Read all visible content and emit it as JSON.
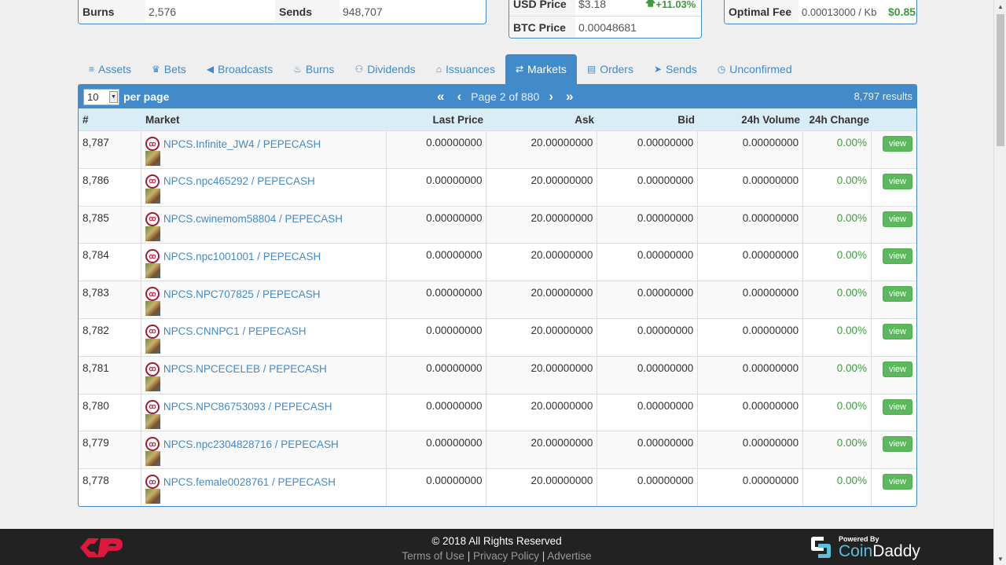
{
  "stats": {
    "burns_label": "Burns",
    "burns_value": "2,576",
    "sends_label": "Sends",
    "sends_value": "948,707",
    "usd_label": "USD Price",
    "usd_value": "$3.18",
    "usd_change": "+11.03%",
    "btc_label": "BTC Price",
    "btc_value": "0.00048681",
    "fee_label": "Optimal Fee",
    "fee_value": "0.00013000 / Kb",
    "fee_usd": "$0.85"
  },
  "tabs": [
    {
      "label": "Assets",
      "icon": "database-icon",
      "glyph": "≡"
    },
    {
      "label": "Bets",
      "icon": "trophy-icon",
      "glyph": "♛"
    },
    {
      "label": "Broadcasts",
      "icon": "bullhorn-icon",
      "glyph": "◀"
    },
    {
      "label": "Burns",
      "icon": "fire-icon",
      "glyph": "♨"
    },
    {
      "label": "Dividends",
      "icon": "sitemap-icon",
      "glyph": "⚇"
    },
    {
      "label": "Issuances",
      "icon": "bank-icon",
      "glyph": "⌂"
    },
    {
      "label": "Markets",
      "icon": "exchange-icon",
      "glyph": "⇄"
    },
    {
      "label": "Orders",
      "icon": "book-icon",
      "glyph": "▤"
    },
    {
      "label": "Sends",
      "icon": "paper-plane-icon",
      "glyph": "➤"
    },
    {
      "label": "Unconfirmed",
      "icon": "clock-icon",
      "glyph": "◷"
    }
  ],
  "active_tab": "Markets",
  "table": {
    "per_page_value": "10",
    "per_page_label": "per page",
    "page_text": "Page 2 of 880",
    "results": "8,797 results",
    "columns": [
      "#",
      "Market",
      "Last Price",
      "Ask",
      "Bid",
      "24h Volume",
      "24h Change"
    ],
    "view_label": "view",
    "rows": [
      {
        "id": "8,787",
        "market": "NPCS.Infinite_JW4 / PEPECASH",
        "last": "0.00000000",
        "ask": "20.00000000",
        "bid": "0.00000000",
        "volume": "0.00000000",
        "change": "0.00%"
      },
      {
        "id": "8,786",
        "market": "NPCS.npc465292 / PEPECASH",
        "last": "0.00000000",
        "ask": "20.00000000",
        "bid": "0.00000000",
        "volume": "0.00000000",
        "change": "0.00%"
      },
      {
        "id": "8,785",
        "market": "NPCS.cwinemom58804 / PEPECASH",
        "last": "0.00000000",
        "ask": "20.00000000",
        "bid": "0.00000000",
        "volume": "0.00000000",
        "change": "0.00%"
      },
      {
        "id": "8,784",
        "market": "NPCS.npc1001001 / PEPECASH",
        "last": "0.00000000",
        "ask": "20.00000000",
        "bid": "0.00000000",
        "volume": "0.00000000",
        "change": "0.00%"
      },
      {
        "id": "8,783",
        "market": "NPCS.NPC707825 / PEPECASH",
        "last": "0.00000000",
        "ask": "20.00000000",
        "bid": "0.00000000",
        "volume": "0.00000000",
        "change": "0.00%"
      },
      {
        "id": "8,782",
        "market": "NPCS.CNNPC1 / PEPECASH",
        "last": "0.00000000",
        "ask": "20.00000000",
        "bid": "0.00000000",
        "volume": "0.00000000",
        "change": "0.00%"
      },
      {
        "id": "8,781",
        "market": "NPCS.NPCECELEB / PEPECASH",
        "last": "0.00000000",
        "ask": "20.00000000",
        "bid": "0.00000000",
        "volume": "0.00000000",
        "change": "0.00%"
      },
      {
        "id": "8,780",
        "market": "NPCS.NPC86753093 / PEPECASH",
        "last": "0.00000000",
        "ask": "20.00000000",
        "bid": "0.00000000",
        "volume": "0.00000000",
        "change": "0.00%"
      },
      {
        "id": "8,779",
        "market": "NPCS.npc2304828716 / PEPECASH",
        "last": "0.00000000",
        "ask": "20.00000000",
        "bid": "0.00000000",
        "volume": "0.00000000",
        "change": "0.00%"
      },
      {
        "id": "8,778",
        "market": "NPCS.female0028761 / PEPECASH",
        "last": "0.00000000",
        "ask": "20.00000000",
        "bid": "0.00000000",
        "volume": "0.00000000",
        "change": "0.00%"
      }
    ]
  },
  "footer": {
    "copyright": "© 2018 All Rights Reserved",
    "terms": "Terms of Use",
    "privacy": "Privacy Policy",
    "advertise": "Advertise",
    "powered_by": "Powered By",
    "brand_a": "Coin",
    "brand_b": "Daddy"
  },
  "colors": {
    "accent": "#428bca",
    "positive": "#3c9c3c",
    "view_button": "#5cb85c",
    "footer_bg": "#222222",
    "brand_red": "#e0173c"
  }
}
